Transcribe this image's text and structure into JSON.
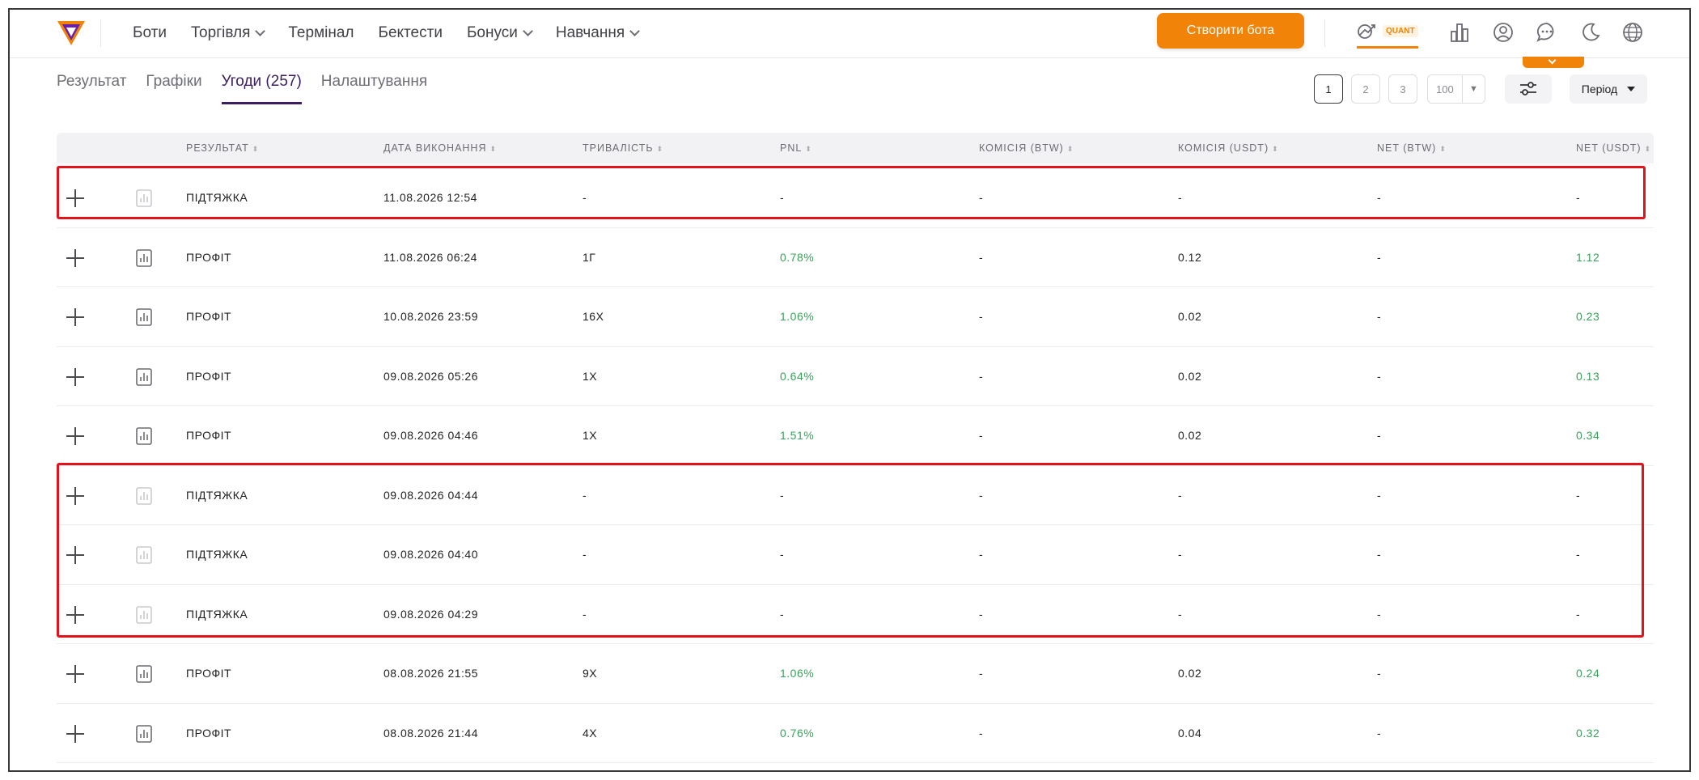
{
  "nav": {
    "items": [
      {
        "label": "Боти",
        "dropdown": false
      },
      {
        "label": "Торгівля",
        "dropdown": true
      },
      {
        "label": "Термінал",
        "dropdown": false
      },
      {
        "label": "Бектести",
        "dropdown": false
      },
      {
        "label": "Бонуси",
        "dropdown": true
      },
      {
        "label": "Навчання",
        "dropdown": true
      }
    ],
    "create_bot": "Створити бота",
    "quant_label": "QUANT",
    "icons": [
      "quant-chart-icon",
      "bar-chart-icon",
      "user-icon",
      "chat-icon",
      "moon-icon",
      "globe-icon"
    ]
  },
  "tabs": [
    {
      "label": "Результат",
      "active": false
    },
    {
      "label": "Графіки",
      "active": false
    },
    {
      "label": "Угоди (257)",
      "active": true
    },
    {
      "label": "Налаштування",
      "active": false
    }
  ],
  "pagination": {
    "pages": [
      "1",
      "2",
      "3"
    ],
    "current": "1",
    "per_page": "100"
  },
  "period_label": "Період",
  "table": {
    "columns": [
      "РЕЗУЛЬТАТ",
      "ДАТА ВИКОНАННЯ",
      "ТРИВАЛІСТЬ",
      "PNL",
      "КОМІСІЯ (BTW)",
      "КОМІСІЯ (USDT)",
      "NET (BTW)",
      "NET (USDT)"
    ],
    "rows": [
      {
        "result": "ПІДТЯЖКА",
        "date": "11.08.2026 12:54",
        "duration": "-",
        "pnl": "-",
        "fee_btw": "-",
        "fee_usdt": "-",
        "net_btw": "-",
        "net_usdt": "-",
        "highlight": true
      },
      {
        "result": "ПРОФІТ",
        "date": "11.08.2026 06:24",
        "duration": "1Г",
        "pnl": "0.78%",
        "fee_btw": "-",
        "fee_usdt": "0.12",
        "net_btw": "-",
        "net_usdt": "1.12",
        "highlight": false
      },
      {
        "result": "ПРОФІТ",
        "date": "10.08.2026 23:59",
        "duration": "16Х",
        "pnl": "1.06%",
        "fee_btw": "-",
        "fee_usdt": "0.02",
        "net_btw": "-",
        "net_usdt": "0.23",
        "highlight": false
      },
      {
        "result": "ПРОФІТ",
        "date": "09.08.2026 05:26",
        "duration": "1Х",
        "pnl": "0.64%",
        "fee_btw": "-",
        "fee_usdt": "0.02",
        "net_btw": "-",
        "net_usdt": "0.13",
        "highlight": false
      },
      {
        "result": "ПРОФІТ",
        "date": "09.08.2026 04:46",
        "duration": "1Х",
        "pnl": "1.51%",
        "fee_btw": "-",
        "fee_usdt": "0.02",
        "net_btw": "-",
        "net_usdt": "0.34",
        "highlight": false
      },
      {
        "result": "ПІДТЯЖКА",
        "date": "09.08.2026 04:44",
        "duration": "-",
        "pnl": "-",
        "fee_btw": "-",
        "fee_usdt": "-",
        "net_btw": "-",
        "net_usdt": "-",
        "highlight": true
      },
      {
        "result": "ПІДТЯЖКА",
        "date": "09.08.2026 04:40",
        "duration": "-",
        "pnl": "-",
        "fee_btw": "-",
        "fee_usdt": "-",
        "net_btw": "-",
        "net_usdt": "-",
        "highlight": true
      },
      {
        "result": "ПІДТЯЖКА",
        "date": "09.08.2026 04:29",
        "duration": "-",
        "pnl": "-",
        "fee_btw": "-",
        "fee_usdt": "-",
        "net_btw": "-",
        "net_usdt": "-",
        "highlight": true
      },
      {
        "result": "ПРОФІТ",
        "date": "08.08.2026 21:55",
        "duration": "9Х",
        "pnl": "1.06%",
        "fee_btw": "-",
        "fee_usdt": "0.02",
        "net_btw": "-",
        "net_usdt": "0.24",
        "highlight": false
      },
      {
        "result": "ПРОФІТ",
        "date": "08.08.2026 21:44",
        "duration": "4Х",
        "pnl": "0.76%",
        "fee_btw": "-",
        "fee_usdt": "0.04",
        "net_btw": "-",
        "net_usdt": "0.32",
        "highlight": false
      }
    ]
  },
  "colors": {
    "accent": "#f08308",
    "active_tab": "#3a1e5e",
    "positive": "#3aa15a",
    "highlight_border": "#e3121b"
  }
}
